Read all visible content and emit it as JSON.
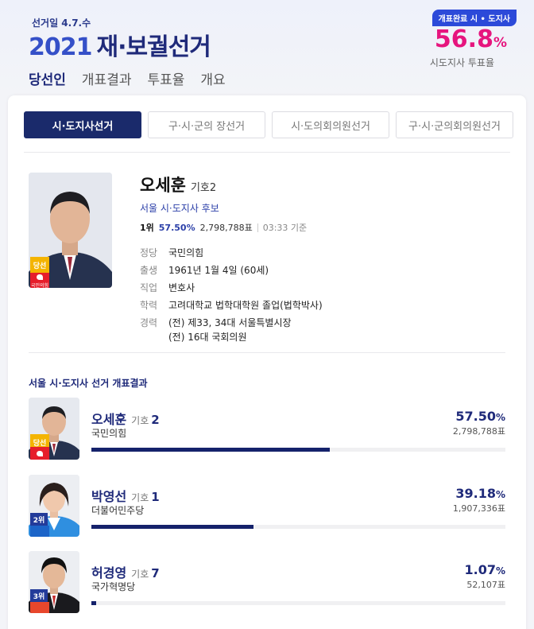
{
  "header": {
    "election_date": "선거일 4.7.수",
    "brand_year": "2021",
    "brand_name": "재·보궐선거",
    "nav": [
      "당선인",
      "개표결과",
      "투표율",
      "개요"
    ],
    "turnout": {
      "badge": "개표완료 시 • 도지사",
      "value": "56.8",
      "unit": "%",
      "label": "시도지사 투표율"
    }
  },
  "subtabs": [
    "시·도지사선거",
    "구·시·군의 장선거",
    "시·도의회의원선거",
    "구·시·군의회의원선거"
  ],
  "winner": {
    "name": "오세훈",
    "number": "기호2",
    "subtitle": "서울 시·도지사 후보",
    "rank": "1위",
    "pct": "57.50%",
    "votes": "2,798,788표",
    "time": "03:33 기준",
    "badge_elected": "당선",
    "badge_party": "국민의힘",
    "details": [
      {
        "k": "정당",
        "v": "국민의힘"
      },
      {
        "k": "출생",
        "v": "1961년 1월 4일 (60세)"
      },
      {
        "k": "직업",
        "v": "변호사"
      },
      {
        "k": "학력",
        "v": "고려대학교 법학대학원 졸업(법학박사)"
      },
      {
        "k": "경력",
        "v": "(전) 제33, 34대 서울특별시장"
      },
      {
        "k": "",
        "v": "(전) 16대 국회의원"
      }
    ]
  },
  "results_title": "서울 시·도지사 선거 개표결과",
  "candidates": [
    {
      "name": "오세훈",
      "num_label": "기호",
      "num": "2",
      "party": "국민의힘",
      "pct": "57.50",
      "pct_unit": "%",
      "votes": "2,798,788표",
      "badge": "당선",
      "party_color": "#e61e2b",
      "share": 57.5
    },
    {
      "name": "박영선",
      "num_label": "기호",
      "num": "1",
      "party": "더불어민주당",
      "pct": "39.18",
      "pct_unit": "%",
      "votes": "1,907,336표",
      "badge": "2위",
      "party_color": "#1c64c8",
      "share": 39.18
    },
    {
      "name": "허경영",
      "num_label": "기호",
      "num": "7",
      "party": "국가혁명당",
      "pct": "1.07",
      "pct_unit": "%",
      "votes": "52,107표",
      "badge": "3위",
      "party_color": "#e8472c",
      "share": 1.07
    }
  ]
}
